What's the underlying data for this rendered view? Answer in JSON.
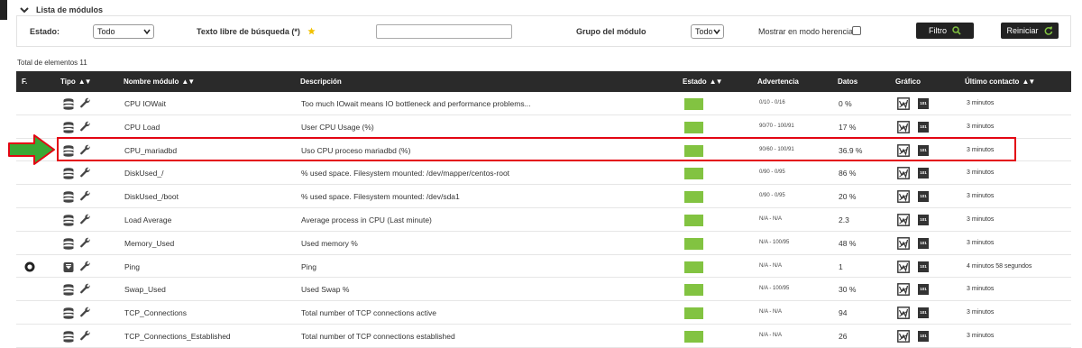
{
  "section": {
    "title": "Lista de módulos"
  },
  "filters": {
    "estado_label": "Estado:",
    "estado_value": "Todo",
    "search_label": "Texto libre de búsqueda (*)",
    "search_value": "",
    "grupo_label": "Grupo del módulo",
    "grupo_value": "Todo",
    "herencia_label": "Mostrar en modo herencia",
    "filter_button": "Filtro",
    "reset_button": "Reiniciar"
  },
  "total_label": "Total de elementos 11",
  "table": {
    "headers": {
      "flag": "F.",
      "tipo": "Tipo",
      "nombre": "Nombre módulo",
      "descripcion": "Descripción",
      "estado": "Estado",
      "advertencia": "Advertencia",
      "datos": "Datos",
      "grafico": "Gráfico",
      "ultimo": "Último contacto"
    },
    "sort_glyph": "▲▼",
    "rows": [
      {
        "name": "CPU IOWait",
        "desc": "Too much IOwait means IO bottleneck and performance problems...",
        "warn": "0/10 - 0/16",
        "data": "0 %",
        "last": "3 minutos",
        "icon": "database-icon",
        "flag": false
      },
      {
        "name": "CPU Load",
        "desc": "User CPU Usage (%)",
        "warn": "90/70 - 100/91",
        "data": "17 %",
        "last": "3 minutos",
        "icon": "database-icon",
        "flag": false
      },
      {
        "name": "CPU_mariadbd",
        "desc": "Uso CPU proceso mariadbd (%)",
        "warn": "90/60 - 100/91",
        "data": "36.9 %",
        "last": "3 minutos",
        "icon": "database-icon",
        "flag": false
      },
      {
        "name": "DiskUsed_/",
        "desc": "% used space. Filesystem mounted: /dev/mapper/centos-root",
        "warn": "0/90 - 0/95",
        "data": "86 %",
        "last": "3 minutos",
        "icon": "database-icon",
        "flag": false
      },
      {
        "name": "DiskUsed_/boot",
        "desc": "% used space. Filesystem mounted: /dev/sda1",
        "warn": "0/90 - 0/95",
        "data": "20 %",
        "last": "3 minutos",
        "icon": "database-icon",
        "flag": false
      },
      {
        "name": "Load Average",
        "desc": "Average process in CPU (Last minute)",
        "warn": "N/A - N/A",
        "data": "2.3",
        "last": "3 minutos",
        "icon": "database-icon",
        "flag": false
      },
      {
        "name": "Memory_Used",
        "desc": "Used memory %",
        "warn": "N/A - 100/95",
        "data": "48 %",
        "last": "3 minutos",
        "icon": "database-icon",
        "flag": false
      },
      {
        "name": "Ping",
        "desc": "Ping",
        "warn": "N/A - N/A",
        "data": "1",
        "last": "4 minutos 58 segundos",
        "icon": "network-icon",
        "flag": true
      },
      {
        "name": "Swap_Used",
        "desc": "Used Swap %",
        "warn": "N/A - 100/95",
        "data": "30 %",
        "last": "3 minutos",
        "icon": "database-icon",
        "flag": false
      },
      {
        "name": "TCP_Connections",
        "desc": "Total number of TCP connections active",
        "warn": "N/A - N/A",
        "data": "94",
        "last": "3 minutos",
        "icon": "database-icon",
        "flag": false
      },
      {
        "name": "TCP_Connections_Established",
        "desc": "Total number of TCP connections established",
        "warn": "N/A - N/A",
        "data": "26",
        "last": "3 minutos",
        "icon": "database-icon",
        "flag": false
      }
    ],
    "raw_icon_text": "101"
  },
  "colors": {
    "status_ok": "#82c341",
    "header_bg": "#2a2a2a",
    "highlight": "#e30613",
    "arrow": "#3aa935"
  }
}
